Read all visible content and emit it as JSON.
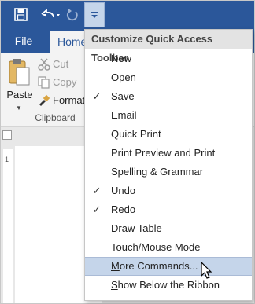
{
  "colors": {
    "ribbon_blue": "#2b579a",
    "highlight": "#c5d5ea"
  },
  "toolbar": {
    "icons": [
      "save-icon",
      "undo-icon",
      "repeat-icon",
      "customize-dropdown-icon"
    ]
  },
  "tabs": {
    "file": "File",
    "home": "Home"
  },
  "clipboard": {
    "paste": "Paste",
    "cut": "Cut",
    "copy": "Copy",
    "format": "Format",
    "group": "Clipboard"
  },
  "ruler": {
    "mark": "1"
  },
  "menu": {
    "title": "Customize Quick Access Toolbar",
    "items": [
      {
        "label": "New",
        "checked": false
      },
      {
        "label": "Open",
        "checked": false
      },
      {
        "label": "Save",
        "checked": true
      },
      {
        "label": "Email",
        "checked": false
      },
      {
        "label": "Quick Print",
        "checked": false
      },
      {
        "label": "Print Preview and Print",
        "checked": false
      },
      {
        "label": "Spelling & Grammar",
        "checked": false
      },
      {
        "label": "Undo",
        "checked": true
      },
      {
        "label": "Redo",
        "checked": true
      },
      {
        "label": "Draw Table",
        "checked": false
      },
      {
        "label": "Touch/Mouse Mode",
        "checked": false
      },
      {
        "label": "More Commands...",
        "checked": false
      },
      {
        "label": "Show Below the Ribbon",
        "checked": false
      }
    ],
    "check_mark": "✓"
  }
}
